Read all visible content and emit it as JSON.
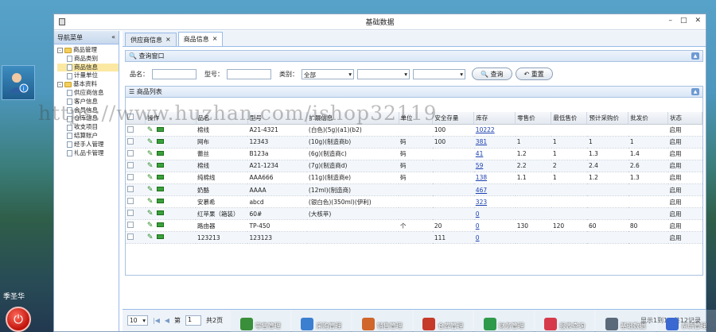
{
  "user": {
    "name": "季圣华"
  },
  "window": {
    "title": "基础数据",
    "icon": "app-icon"
  },
  "nav": {
    "title": "导航菜单",
    "collapse_label": "«",
    "tree": [
      {
        "label": "商品管理",
        "level": 0,
        "type": "folder",
        "expand": "-"
      },
      {
        "label": "商品类别",
        "level": 1,
        "type": "doc"
      },
      {
        "label": "商品信息",
        "level": 1,
        "type": "doc",
        "selected": true
      },
      {
        "label": "计量单位",
        "level": 1,
        "type": "doc"
      },
      {
        "label": "基本资料",
        "level": 0,
        "type": "folder",
        "expand": "-"
      },
      {
        "label": "供应商信息",
        "level": 1,
        "type": "doc"
      },
      {
        "label": "客户信息",
        "level": 1,
        "type": "doc"
      },
      {
        "label": "会员信息",
        "level": 1,
        "type": "doc"
      },
      {
        "label": "仓库信息",
        "level": 1,
        "type": "doc"
      },
      {
        "label": "收支项目",
        "level": 1,
        "type": "doc"
      },
      {
        "label": "结算账户",
        "level": 1,
        "type": "doc"
      },
      {
        "label": "经手人管理",
        "level": 1,
        "type": "doc"
      },
      {
        "label": "礼品卡管理",
        "level": 1,
        "type": "doc"
      }
    ]
  },
  "tabs": [
    {
      "label": "供应商信息",
      "close": "×"
    },
    {
      "label": "商品信息",
      "close": "×",
      "active": true
    }
  ],
  "query": {
    "panel_title": "查询窗口",
    "name_label": "品名：",
    "model_label": "型号：",
    "category_label": "类别：",
    "category_value": "全部",
    "search_label": "查询",
    "reset_label": "重置"
  },
  "list": {
    "panel_title": "商品列表",
    "columns": [
      "操作",
      "品名",
      "型号",
      "扩展信息",
      "单位",
      "安全存量",
      "库存",
      "零售价",
      "最低售价",
      "预计采购价",
      "批发价",
      "状态"
    ],
    "rows": [
      {
        "name": "棉线",
        "model": "A21-4321",
        "ext": "(白色)(5g)(a1)(b2)",
        "unit": "",
        "safe": "100",
        "stock": "10222",
        "retail": "",
        "min": "",
        "purchase": "",
        "wholesale": "",
        "status": "启用"
      },
      {
        "name": "网布",
        "model": "12343",
        "ext": "(10g)(制造商b)",
        "unit": "码",
        "safe": "100",
        "stock": "381",
        "retail": "1",
        "min": "1",
        "purchase": "1",
        "wholesale": "1",
        "status": "启用"
      },
      {
        "name": "蕾丝",
        "model": "B123a",
        "ext": "(6g)(制造商c)",
        "unit": "码",
        "safe": "",
        "stock": "41",
        "retail": "1.2",
        "min": "1",
        "purchase": "1.3",
        "wholesale": "1.4",
        "status": "启用"
      },
      {
        "name": "棉线",
        "model": "A21-1234",
        "ext": "(7g)(制造商d)",
        "unit": "码",
        "safe": "",
        "stock": "59",
        "retail": "2.2",
        "min": "2",
        "purchase": "2.4",
        "wholesale": "2.6",
        "status": "启用"
      },
      {
        "name": "纯棉线",
        "model": "AAA666",
        "ext": "(11g)(制造商e)",
        "unit": "码",
        "safe": "",
        "stock": "138",
        "retail": "1.1",
        "min": "1",
        "purchase": "1.2",
        "wholesale": "1.3",
        "status": "启用"
      },
      {
        "name": "奶酪",
        "model": "AAAA",
        "ext": "(12ml)(制造商)",
        "unit": "",
        "safe": "",
        "stock": "467",
        "retail": "",
        "min": "",
        "purchase": "",
        "wholesale": "",
        "status": "启用"
      },
      {
        "name": "安慕希",
        "model": "abcd",
        "ext": "(银白色)(350ml)(伊利)",
        "unit": "",
        "safe": "",
        "stock": "323",
        "retail": "",
        "min": "",
        "purchase": "",
        "wholesale": "",
        "status": "启用"
      },
      {
        "name": "红苹果（箱装）",
        "model": "60#",
        "ext": "(大核苹)",
        "unit": "",
        "safe": "",
        "stock": "0",
        "retail": "",
        "min": "",
        "purchase": "",
        "wholesale": "",
        "status": "启用"
      },
      {
        "name": "路由器",
        "model": "TP-450",
        "ext": "",
        "unit": "个",
        "safe": "20",
        "stock": "0",
        "retail": "130",
        "min": "120",
        "purchase": "60",
        "wholesale": "80",
        "status": "启用"
      },
      {
        "name": "123213",
        "model": "123123",
        "ext": "",
        "unit": "",
        "safe": "111",
        "stock": "0",
        "retail": "",
        "min": "",
        "purchase": "",
        "wholesale": "",
        "status": "启用"
      }
    ]
  },
  "pager": {
    "page_size": "10",
    "page_prefix": "第",
    "page": "1",
    "page_total": "共2页",
    "summary": "显示1到10,共12记录"
  },
  "watermark": "https://www.huzhan.com/ishop32119",
  "taskbar": [
    {
      "label": "零售管理",
      "color": "#3a8f3a"
    },
    {
      "label": "采购管理",
      "color": "#3b7fd1"
    },
    {
      "label": "销售管理",
      "color": "#d0662a"
    },
    {
      "label": "仓库管理",
      "color": "#c63a2a"
    },
    {
      "label": "财务管理",
      "color": "#2e9a4a"
    },
    {
      "label": "报表查询",
      "color": "#d63a4a"
    },
    {
      "label": "基础数据",
      "color": "#5a6a7a"
    },
    {
      "label": "系统管理",
      "color": "#3a6ad1"
    }
  ]
}
